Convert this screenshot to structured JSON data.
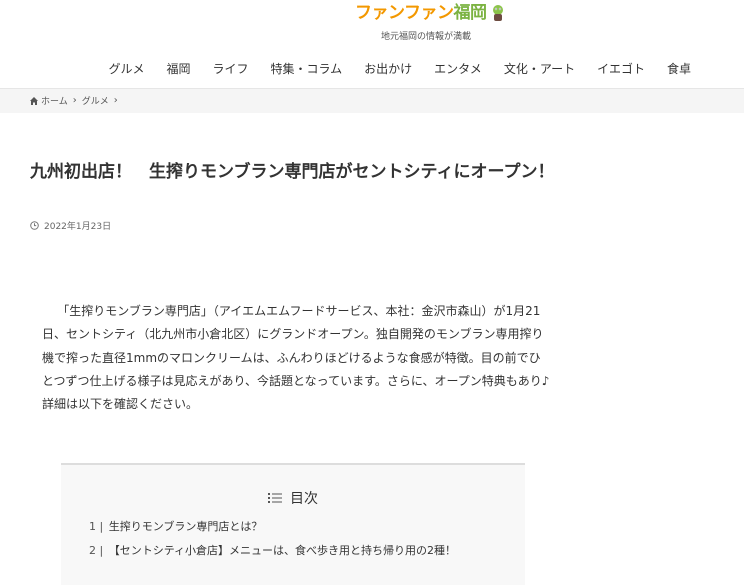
{
  "header": {
    "logo_text": "ファンファン福岡",
    "tagline": "地元福岡の情報が満載",
    "colors": {
      "logo_orange": "#f39800",
      "logo_green": "#7cb342"
    }
  },
  "nav": {
    "items": [
      "グルメ",
      "福岡",
      "ライフ",
      "特集・コラム",
      "お出かけ",
      "エンタメ",
      "文化・アート",
      "イエゴト",
      "食卓"
    ]
  },
  "breadcrumb": {
    "home": "ホーム",
    "category": "グルメ"
  },
  "article": {
    "title": "九州初出店！　生搾りモンブラン専門店がセントシティにオープン！",
    "date": "2022年1月23日",
    "body": "「生搾りモンブラン専門店」（アイエムエムフードサービス、本社：金沢市森山）が1月21日、セントシティ（北九州市小倉北区）にグランドオープン。独自開発のモンブラン専用搾り機で搾った直径1mmのマロンクリームは、ふんわりほどけるような食感が特徴。目の前でひとつずつ仕上げる様子は見応えがあり、今話題となっています。さらに、オープン特典もあり♪ 詳細は以下を確認ください。"
  },
  "toc": {
    "title": "目次",
    "items": [
      {
        "num": "1 |",
        "label": "生搾りモンブラン専門店とは？"
      },
      {
        "num": "2 |",
        "label": "【セントシティ小倉店】メニューは、食べ歩き用と持ち帰り用の2種！"
      }
    ]
  }
}
